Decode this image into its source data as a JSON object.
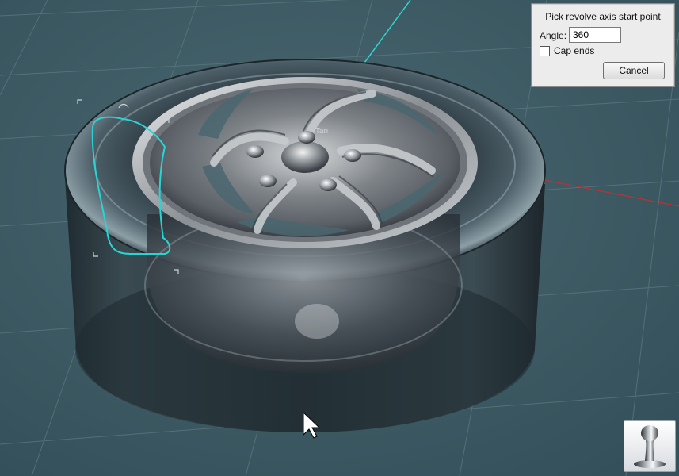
{
  "scene": {
    "background_color": "#3e5961",
    "axis_colors": {
      "y_axis": "#2ad7d0",
      "x_axis": "#c03030"
    },
    "profile_curve_color": "#27d6d4",
    "snap_label": "Tan"
  },
  "revolve_panel": {
    "title": "Pick revolve axis start point",
    "angle_label": "Angle:",
    "angle_value": "360",
    "cap_ends_label": "Cap ends",
    "cap_ends_checked": false,
    "cancel_label": "Cancel"
  },
  "toolbar": {
    "active_tool_icon": "revolve-tool-icon"
  },
  "cursor": {
    "icon": "arrow-cursor-icon"
  }
}
